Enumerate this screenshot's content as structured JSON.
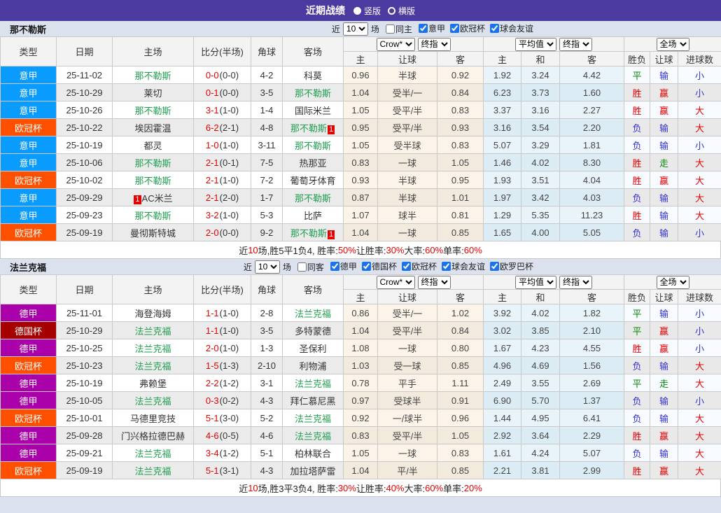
{
  "topbar": {
    "title": "近期战绩",
    "vertical_label": "竖版",
    "horizontal_label": "横版"
  },
  "colors": {
    "topbar_bg": "#4b3ba0",
    "team_green": "#1e9e4e",
    "score_red": "#e60000",
    "summary_red": "#e60000",
    "checkbox_blue": "#1a73e8"
  },
  "league_colors": {
    "意甲": "#0a9bff",
    "欧冠杯": "#ff5000",
    "德甲": "#aa00aa",
    "德国杯": "#a40000"
  },
  "result_colors": {
    "胜": "#e60000",
    "赢": "#e60000",
    "大": "#e60000",
    "负": "#3333cc",
    "输": "#3333cc",
    "小": "#3333cc",
    "平": "#0a8a0a",
    "走": "#0a8a0a"
  },
  "table_header": {
    "type": "类型",
    "date": "日期",
    "home": "主场",
    "score": "比分(半场)",
    "corner": "角球",
    "away": "客场",
    "selects": {
      "crow": "Crow*",
      "final1": "终指",
      "avg": "平均值",
      "final2": "终指",
      "full": "全场"
    },
    "sub": [
      "主",
      "让球",
      "客",
      "主",
      "和",
      "客",
      "胜负",
      "让球",
      "进球数"
    ]
  },
  "sections": [
    {
      "team": "那不勒斯",
      "filter": {
        "near": "近",
        "count": "10",
        "unit": "场",
        "same_label": "同主",
        "leagues": [
          "意甲",
          "欧冠杯",
          "球会友谊"
        ]
      },
      "rows": [
        {
          "league": "意甲",
          "date": "25-11-02",
          "home": {
            "name": "那不勒斯",
            "self": true
          },
          "score": "0-0",
          "half": "(0-0)",
          "corner": "4-2",
          "away": {
            "name": "科莫"
          },
          "odds": [
            "0.96",
            "半球",
            "0.92"
          ],
          "avg": [
            "1.92",
            "3.24",
            "4.42"
          ],
          "results": [
            "平",
            "输",
            "小"
          ]
        },
        {
          "league": "意甲",
          "date": "25-10-29",
          "home": {
            "name": "莱切"
          },
          "score": "0-1",
          "half": "(0-0)",
          "corner": "3-5",
          "away": {
            "name": "那不勒斯",
            "self": true
          },
          "odds": [
            "1.04",
            "受半/一",
            "0.84"
          ],
          "avg": [
            "6.23",
            "3.73",
            "1.60"
          ],
          "results": [
            "胜",
            "赢",
            "小"
          ]
        },
        {
          "league": "意甲",
          "date": "25-10-26",
          "home": {
            "name": "那不勒斯",
            "self": true
          },
          "score": "3-1",
          "half": "(1-0)",
          "corner": "1-4",
          "away": {
            "name": "国际米兰"
          },
          "odds": [
            "1.05",
            "受平/半",
            "0.83"
          ],
          "avg": [
            "3.37",
            "3.16",
            "2.27"
          ],
          "results": [
            "胜",
            "赢",
            "大"
          ]
        },
        {
          "league": "欧冠杯",
          "date": "25-10-22",
          "home": {
            "name": "埃因霍温"
          },
          "score": "6-2",
          "half": "(2-1)",
          "corner": "4-8",
          "away": {
            "name": "那不勒斯",
            "self": true,
            "card": "1",
            "card_pos": "after"
          },
          "odds": [
            "0.95",
            "受平/半",
            "0.93"
          ],
          "avg": [
            "3.16",
            "3.54",
            "2.20"
          ],
          "results": [
            "负",
            "输",
            "大"
          ]
        },
        {
          "league": "意甲",
          "date": "25-10-19",
          "home": {
            "name": "都灵"
          },
          "score": "1-0",
          "half": "(1-0)",
          "corner": "3-11",
          "away": {
            "name": "那不勒斯",
            "self": true
          },
          "odds": [
            "1.05",
            "受半球",
            "0.83"
          ],
          "avg": [
            "5.07",
            "3.29",
            "1.81"
          ],
          "results": [
            "负",
            "输",
            "小"
          ]
        },
        {
          "league": "意甲",
          "date": "25-10-06",
          "home": {
            "name": "那不勒斯",
            "self": true
          },
          "score": "2-1",
          "half": "(0-1)",
          "corner": "7-5",
          "away": {
            "name": "热那亚"
          },
          "odds": [
            "0.83",
            "一球",
            "1.05"
          ],
          "avg": [
            "1.46",
            "4.02",
            "8.30"
          ],
          "results": [
            "胜",
            "走",
            "大"
          ]
        },
        {
          "league": "欧冠杯",
          "date": "25-10-02",
          "home": {
            "name": "那不勒斯",
            "self": true
          },
          "score": "2-1",
          "half": "(1-0)",
          "corner": "7-2",
          "away": {
            "name": "葡萄牙体育"
          },
          "odds": [
            "0.93",
            "半球",
            "0.95"
          ],
          "avg": [
            "1.93",
            "3.51",
            "4.04"
          ],
          "results": [
            "胜",
            "赢",
            "大"
          ]
        },
        {
          "league": "意甲",
          "date": "25-09-29",
          "home": {
            "name": "AC米兰",
            "card": "1",
            "card_pos": "before"
          },
          "score": "2-1",
          "half": "(2-0)",
          "corner": "1-7",
          "away": {
            "name": "那不勒斯",
            "self": true
          },
          "odds": [
            "0.87",
            "半球",
            "1.01"
          ],
          "avg": [
            "1.97",
            "3.42",
            "4.03"
          ],
          "results": [
            "负",
            "输",
            "大"
          ]
        },
        {
          "league": "意甲",
          "date": "25-09-23",
          "home": {
            "name": "那不勒斯",
            "self": true
          },
          "score": "3-2",
          "half": "(1-0)",
          "corner": "5-3",
          "away": {
            "name": "比萨"
          },
          "odds": [
            "1.07",
            "球半",
            "0.81"
          ],
          "avg": [
            "1.29",
            "5.35",
            "11.23"
          ],
          "results": [
            "胜",
            "输",
            "大"
          ]
        },
        {
          "league": "欧冠杯",
          "date": "25-09-19",
          "home": {
            "name": "曼彻斯特城"
          },
          "score": "2-0",
          "half": "(0-0)",
          "corner": "9-2",
          "away": {
            "name": "那不勒斯",
            "self": true,
            "card": "1",
            "card_pos": "after"
          },
          "odds": [
            "1.04",
            "一球",
            "0.85"
          ],
          "avg": [
            "1.65",
            "4.00",
            "5.05"
          ],
          "results": [
            "负",
            "输",
            "小"
          ]
        }
      ],
      "summary": [
        {
          "t": "近"
        },
        {
          "t": "10",
          "red": true
        },
        {
          "t": "场,胜5平1负4, 胜率:"
        },
        {
          "t": "50%",
          "red": true
        },
        {
          "t": " 让胜率:"
        },
        {
          "t": "30%",
          "red": true
        },
        {
          "t": " 大率:"
        },
        {
          "t": "60%",
          "red": true
        },
        {
          "t": " 单率:"
        },
        {
          "t": "60%",
          "red": true
        }
      ]
    },
    {
      "team": "法兰克福",
      "filter": {
        "near": "近",
        "count": "10",
        "unit": "场",
        "same_label": "同客",
        "leagues": [
          "德甲",
          "德国杯",
          "欧冠杯",
          "球会友谊",
          "欧罗巴杯"
        ]
      },
      "rows": [
        {
          "league": "德甲",
          "date": "25-11-01",
          "home": {
            "name": "海登海姆"
          },
          "score": "1-1",
          "half": "(1-0)",
          "corner": "2-8",
          "away": {
            "name": "法兰克福",
            "self": true
          },
          "odds": [
            "0.86",
            "受半/一",
            "1.02"
          ],
          "avg": [
            "3.92",
            "4.02",
            "1.82"
          ],
          "results": [
            "平",
            "输",
            "小"
          ]
        },
        {
          "league": "德国杯",
          "date": "25-10-29",
          "home": {
            "name": "法兰克福",
            "self": true
          },
          "score": "1-1",
          "half": "(1-0)",
          "corner": "3-5",
          "away": {
            "name": "多特蒙德"
          },
          "odds": [
            "1.04",
            "受平/半",
            "0.84"
          ],
          "avg": [
            "3.02",
            "3.85",
            "2.10"
          ],
          "results": [
            "平",
            "赢",
            "小"
          ]
        },
        {
          "league": "德甲",
          "date": "25-10-25",
          "home": {
            "name": "法兰克福",
            "self": true
          },
          "score": "2-0",
          "half": "(1-0)",
          "corner": "1-3",
          "away": {
            "name": "圣保利"
          },
          "odds": [
            "1.08",
            "一球",
            "0.80"
          ],
          "avg": [
            "1.67",
            "4.23",
            "4.55"
          ],
          "results": [
            "胜",
            "赢",
            "小"
          ]
        },
        {
          "league": "欧冠杯",
          "date": "25-10-23",
          "home": {
            "name": "法兰克福",
            "self": true
          },
          "score": "1-5",
          "half": "(1-3)",
          "corner": "2-10",
          "away": {
            "name": "利物浦"
          },
          "odds": [
            "1.03",
            "受一球",
            "0.85"
          ],
          "avg": [
            "4.96",
            "4.69",
            "1.56"
          ],
          "results": [
            "负",
            "输",
            "大"
          ]
        },
        {
          "league": "德甲",
          "date": "25-10-19",
          "home": {
            "name": "弗赖堡"
          },
          "score": "2-2",
          "half": "(1-2)",
          "corner": "3-1",
          "away": {
            "name": "法兰克福",
            "self": true
          },
          "odds": [
            "0.78",
            "平手",
            "1.11"
          ],
          "avg": [
            "2.49",
            "3.55",
            "2.69"
          ],
          "results": [
            "平",
            "走",
            "大"
          ]
        },
        {
          "league": "德甲",
          "date": "25-10-05",
          "home": {
            "name": "法兰克福",
            "self": true
          },
          "score": "0-3",
          "half": "(0-2)",
          "corner": "4-3",
          "away": {
            "name": "拜仁慕尼黑"
          },
          "odds": [
            "0.97",
            "受球半",
            "0.91"
          ],
          "avg": [
            "6.90",
            "5.70",
            "1.37"
          ],
          "results": [
            "负",
            "输",
            "小"
          ]
        },
        {
          "league": "欧冠杯",
          "date": "25-10-01",
          "home": {
            "name": "马德里竞技"
          },
          "score": "5-1",
          "half": "(3-0)",
          "corner": "5-2",
          "away": {
            "name": "法兰克福",
            "self": true
          },
          "odds": [
            "0.92",
            "一/球半",
            "0.96"
          ],
          "avg": [
            "1.44",
            "4.95",
            "6.41"
          ],
          "results": [
            "负",
            "输",
            "大"
          ]
        },
        {
          "league": "德甲",
          "date": "25-09-28",
          "home": {
            "name": "门兴格拉德巴赫"
          },
          "score": "4-6",
          "half": "(0-5)",
          "corner": "4-6",
          "away": {
            "name": "法兰克福",
            "self": true
          },
          "odds": [
            "0.83",
            "受平/半",
            "1.05"
          ],
          "avg": [
            "2.92",
            "3.64",
            "2.29"
          ],
          "results": [
            "胜",
            "赢",
            "大"
          ]
        },
        {
          "league": "德甲",
          "date": "25-09-21",
          "home": {
            "name": "法兰克福",
            "self": true
          },
          "score": "3-4",
          "half": "(1-2)",
          "corner": "5-1",
          "away": {
            "name": "柏林联合"
          },
          "odds": [
            "1.05",
            "一球",
            "0.83"
          ],
          "avg": [
            "1.61",
            "4.24",
            "5.07"
          ],
          "results": [
            "负",
            "输",
            "大"
          ]
        },
        {
          "league": "欧冠杯",
          "date": "25-09-19",
          "home": {
            "name": "法兰克福",
            "self": true
          },
          "score": "5-1",
          "half": "(3-1)",
          "corner": "4-3",
          "away": {
            "name": "加拉塔萨雷"
          },
          "odds": [
            "1.04",
            "平/半",
            "0.85"
          ],
          "avg": [
            "2.21",
            "3.81",
            "2.99"
          ],
          "results": [
            "胜",
            "赢",
            "大"
          ]
        }
      ],
      "summary": [
        {
          "t": "近"
        },
        {
          "t": "10",
          "red": true
        },
        {
          "t": "场,胜3平3负4, 胜率:"
        },
        {
          "t": "30%",
          "red": true
        },
        {
          "t": " 让胜率:"
        },
        {
          "t": "40%",
          "red": true
        },
        {
          "t": " 大率:"
        },
        {
          "t": "60%",
          "red": true
        },
        {
          "t": " 单率:"
        },
        {
          "t": "20%",
          "red": true
        }
      ]
    }
  ]
}
